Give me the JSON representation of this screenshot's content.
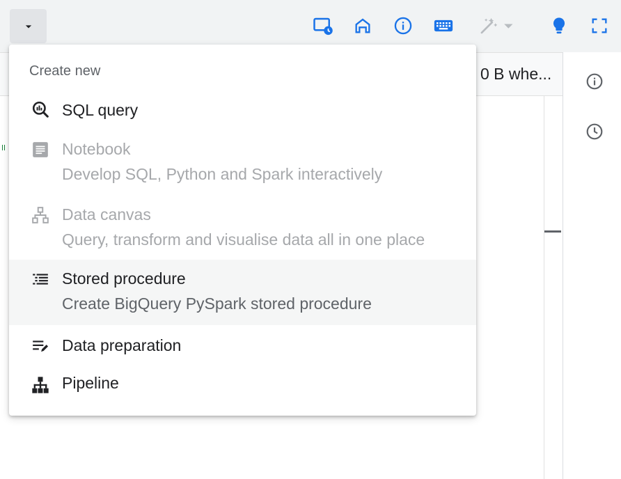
{
  "colors": {
    "primary": "#1a73e8",
    "toolbar_bg": "#f1f3f4",
    "text": "#202124",
    "secondary_text": "#5f6368",
    "disabled_text": "#a6a8ab"
  },
  "toolbar": {
    "dropdown_icon": "arrow-drop-down-icon",
    "icons": [
      "schedule-screen-icon",
      "home-icon",
      "info-icon",
      "keyboard-icon",
      "magic-wand-icon",
      "lightbulb-icon",
      "fullscreen-icon"
    ]
  },
  "subbar": {
    "estimate_text": "0 B whe..."
  },
  "menu": {
    "header": "Create new",
    "items": [
      {
        "title": "SQL query",
        "icon": "sql-query-icon",
        "disabled": false
      },
      {
        "title": "Notebook",
        "subtitle": "Develop SQL, Python and Spark interactively",
        "icon": "notebook-icon",
        "disabled": true
      },
      {
        "title": "Data canvas",
        "subtitle": "Query, transform and visualise data all in one place",
        "icon": "data-canvas-icon",
        "disabled": true
      },
      {
        "title": "Stored procedure",
        "subtitle": "Create BigQuery PySpark stored procedure",
        "icon": "stored-procedure-icon",
        "disabled": false,
        "highlighted": true
      },
      {
        "title": "Data preparation",
        "icon": "data-preparation-icon",
        "disabled": false
      },
      {
        "title": "Pipeline",
        "icon": "pipeline-icon",
        "disabled": false
      }
    ]
  },
  "right_panel": {
    "icons": [
      "info-outline-icon",
      "history-icon"
    ]
  }
}
